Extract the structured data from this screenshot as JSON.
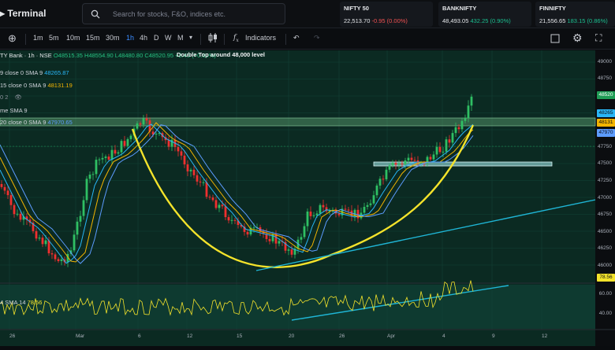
{
  "app": {
    "title": "Terminal"
  },
  "search": {
    "placeholder": "Search for stocks, F&O, indices etc."
  },
  "tickers": [
    {
      "name": "NIFTY 50",
      "price": "22,513.70",
      "change": "-0.95 (0.00%)",
      "dir": "neg"
    },
    {
      "name": "BANKNIFTY",
      "price": "48,493.05",
      "change": "432.25 (0.90%)",
      "dir": "pos"
    },
    {
      "name": "FINNIFTY",
      "price": "21,556.65",
      "change": "183.15 (0.86%)",
      "dir": "pos"
    }
  ],
  "toolbar": {
    "intervals": [
      "1m",
      "5m",
      "10m",
      "15m",
      "30m",
      "1h",
      "4h",
      "D",
      "W",
      "M"
    ],
    "active": "1h",
    "indicators_label": "Indicators",
    "fx_label": "f"
  },
  "legend": {
    "symbol": "TY Bank · 1h · NSE",
    "ohlc": "O48515.35 H48554.90 L48480.80 C48520.95 +2.40 (+0.00%)",
    "sma1_label": "9 close 0 SMA 9",
    "sma1_value": "48265.87",
    "sma2_label": "15 close 0 SMA 9",
    "sma2_value": "48131.19",
    "counter": "0 2",
    "vol_label": "me SMA 9",
    "sma3_label": "20 close 0 SMA 9",
    "sma3_value": "47970.65",
    "rsi_label": "4 SMA 14",
    "rsi_value": "78.56"
  },
  "annotation": {
    "title": "Double Top around 48,000 level"
  },
  "price_axis": [
    "49000",
    "48750",
    "48520",
    "48265",
    "48131",
    "47970",
    "47750",
    "47500",
    "47250",
    "47000",
    "46750",
    "46500",
    "46250",
    "46000"
  ],
  "rsi_axis": [
    "78.56",
    "60.00",
    "40.00"
  ],
  "time_axis": [
    "26",
    "Mar",
    "6",
    "12",
    "15",
    "20",
    "26",
    "Apr",
    "4",
    "9",
    "12"
  ],
  "colors": {
    "bg": "#0b2a22",
    "up": "#2fbf63",
    "down": "#ef2f2f",
    "curve": "#f4e32b",
    "trend": "#1fb6d6",
    "accent": "#3b8bff"
  }
}
